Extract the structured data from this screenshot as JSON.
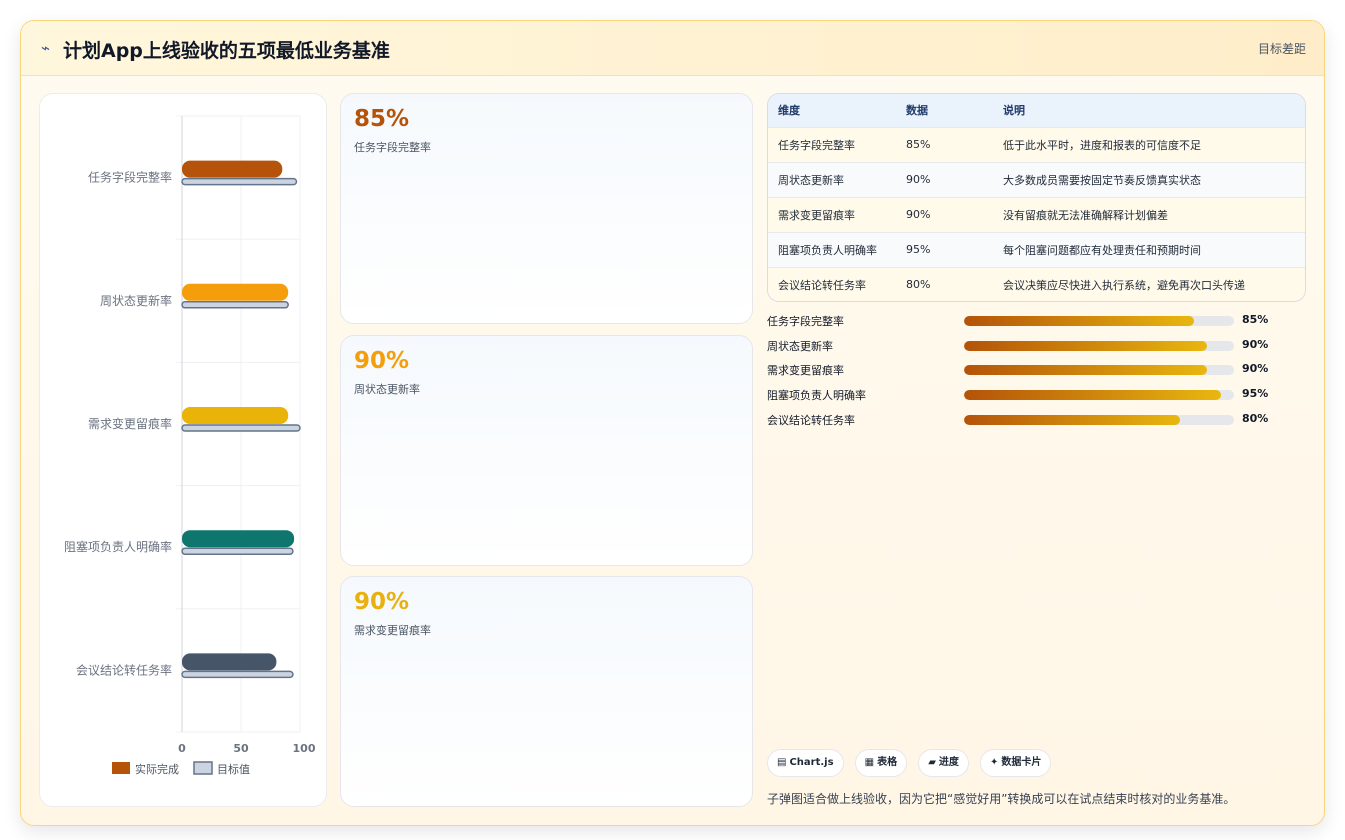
{
  "header": {
    "icon": "trend-icon",
    "title": "计划App上线验收的五项最低业务基准",
    "tag": "目标差距"
  },
  "chart_data": {
    "type": "bar",
    "orientation": "horizontal",
    "categories": [
      "任务字段完整率",
      "周状态更新率",
      "需求变更留痕率",
      "阻塞项负责人明确率",
      "会议结论转任务率"
    ],
    "series": [
      {
        "name": "实际完成",
        "values": [
          85,
          90,
          90,
          95,
          80
        ],
        "colors": [
          "#b45309",
          "#f59e0b",
          "#eab308",
          "#0f766e",
          "#475569"
        ]
      },
      {
        "name": "目标值",
        "values": [
          97,
          90,
          100,
          94,
          94
        ],
        "color": "#cbd5e1",
        "border": "#64748b"
      }
    ],
    "xticks": [
      "0",
      "50",
      "100"
    ],
    "xlim": [
      0,
      100
    ],
    "legend": "bottom",
    "grid": true
  },
  "cards": [
    {
      "value": "85%",
      "label": "任务字段完整率",
      "color": "#b45309"
    },
    {
      "value": "90%",
      "label": "周状态更新率",
      "color": "#f59e0b"
    },
    {
      "value": "90%",
      "label": "需求变更留痕率",
      "color": "#e8b10f"
    }
  ],
  "table": {
    "headers": [
      "维度",
      "数据",
      "说明"
    ],
    "rows": [
      [
        "任务字段完整率",
        "85%",
        "低于此水平时，进度和报表的可信度不足"
      ],
      [
        "周状态更新率",
        "90%",
        "大多数成员需要按固定节奏反馈真实状态"
      ],
      [
        "需求变更留痕率",
        "90%",
        "没有留痕就无法准确解释计划偏差"
      ],
      [
        "阻塞项负责人明确率",
        "95%",
        "每个阻塞问题都应有处理责任和预期时间"
      ],
      [
        "会议结论转任务率",
        "80%",
        "会议决策应尽快进入执行系统，避免再次口头传递"
      ]
    ]
  },
  "progress": [
    {
      "label": "任务字段完整率",
      "pct": 85,
      "text": "85%"
    },
    {
      "label": "周状态更新率",
      "pct": 90,
      "text": "90%"
    },
    {
      "label": "需求变更留痕率",
      "pct": 90,
      "text": "90%"
    },
    {
      "label": "阻塞项负责人明确率",
      "pct": 95,
      "text": "95%"
    },
    {
      "label": "会议结论转任务率",
      "pct": 80,
      "text": "80%"
    }
  ],
  "chips": [
    {
      "icon": "chart-icon",
      "glyph": "▤",
      "label": "Chart.js"
    },
    {
      "icon": "table-icon",
      "glyph": "▦",
      "label": "表格"
    },
    {
      "icon": "progress-icon",
      "glyph": "▰",
      "label": "进度"
    },
    {
      "icon": "sparkle-icon",
      "glyph": "✦",
      "label": "数据卡片"
    }
  ],
  "footnote": "子弹图适合做上线验收，因为它把“感觉好用”转换成可以在试点结束时核对的业务基准。"
}
